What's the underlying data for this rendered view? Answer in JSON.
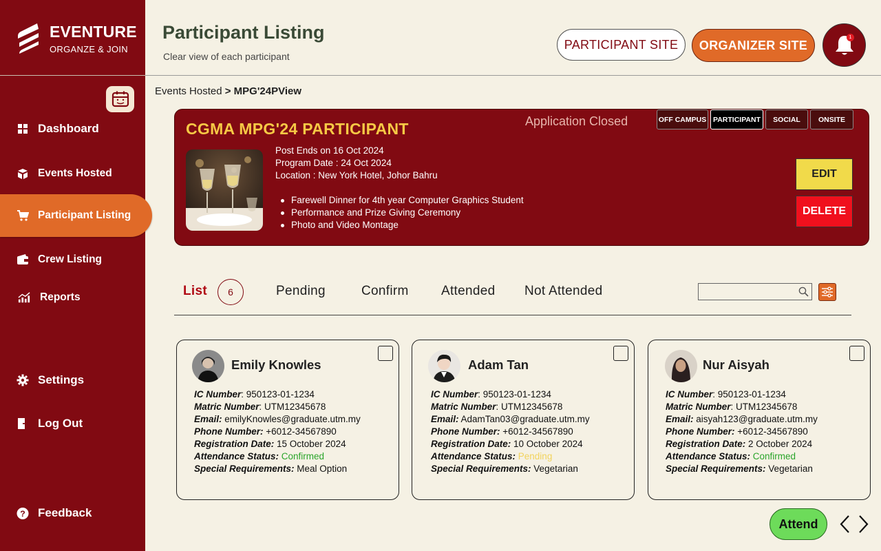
{
  "brand": {
    "name": "EVENTURE",
    "tagline": "ORGANZE & JOIN"
  },
  "sidebar": {
    "items": [
      {
        "label": "Dashboard",
        "icon": "dashboard-grid-icon"
      },
      {
        "label": "Events Hosted",
        "icon": "box-icon"
      },
      {
        "label": "Participant Listing",
        "icon": "cart-icon",
        "active": true
      },
      {
        "label": "Crew Listing",
        "icon": "wallet-icon"
      },
      {
        "label": "Reports",
        "icon": "chart-icon"
      }
    ],
    "settings_label": "Settings",
    "logout_label": "Log Out",
    "feedback_label": "Feedback"
  },
  "header": {
    "title": "Participant Listing",
    "subtitle": "Clear view of each participant",
    "participant_site": "PARTICIPANT SITE",
    "organizer_site": "ORGANIZER SITE",
    "notification_count": "1"
  },
  "breadcrumb": {
    "parent": "Events Hosted",
    "sep": ">",
    "current": "MPG'24PView"
  },
  "event": {
    "title": "CGMA MPG'24 PARTICIPANT",
    "status": "Application Closed",
    "tags": [
      "OFF CAMPUS",
      "PARTICIPANT",
      "SOCIAL",
      "ONSITE"
    ],
    "post_ends": "Post Ends on 16 Oct 2024",
    "program_date": "Program Date : 24 Oct 2024",
    "location": "Location : New York Hotel, Johor Bahru",
    "bullets": [
      "Farewell Dinner for 4th year Computer Graphics Student",
      "Performance and Prize Giving Ceremony",
      "Photo and Video Montage"
    ],
    "edit_label": "EDIT",
    "delete_label": "DELETE"
  },
  "tabs": {
    "list_label": "List",
    "list_count": "6",
    "pending": "Pending",
    "confirm": "Confirm",
    "attended": "Attended",
    "not_attended": "Not Attended",
    "search_value": ""
  },
  "field_labels": {
    "ic": "IC Number",
    "matric": "Matric Number",
    "email": "Email:",
    "phone": "Phone Number:",
    "reg_date": "Registration Date:",
    "status": "Attendance Status:",
    "special": "Special Requirements:"
  },
  "participants": [
    {
      "name": "Emily Knowles",
      "ic": ": 950123-01-1234",
      "matric": ": UTM12345678",
      "email": " emilyKnowles@graduate.utm.my",
      "phone": " +6012-34567890",
      "reg_date": " 15 October 2024",
      "status": " Confirmed",
      "special": " Meal Option"
    },
    {
      "name": "Adam Tan",
      "ic": ": 950123-01-1234",
      "matric": ": UTM12345678",
      "email": " AdamTan03@graduate.utm.my",
      "phone": " +6012-34567890",
      "reg_date": " 10 October 2024",
      "status": " Pending",
      "special": " Vegetarian"
    },
    {
      "name": "Nur Aisyah",
      "ic": ": 950123-01-1234",
      "matric": ": UTM12345678",
      "email": " aisyah123@graduate.utm.my",
      "phone": " +6012-34567890",
      "reg_date": " 2 October 2024",
      "status": " Confirmed",
      "special": " Vegetarian"
    }
  ],
  "attend_label": "Attend",
  "colors": {
    "maroon": "#810a12",
    "orange": "#e06a28",
    "gold": "#f6c945",
    "confirmed": "#2aa52a",
    "pending": "#f2d35c"
  }
}
